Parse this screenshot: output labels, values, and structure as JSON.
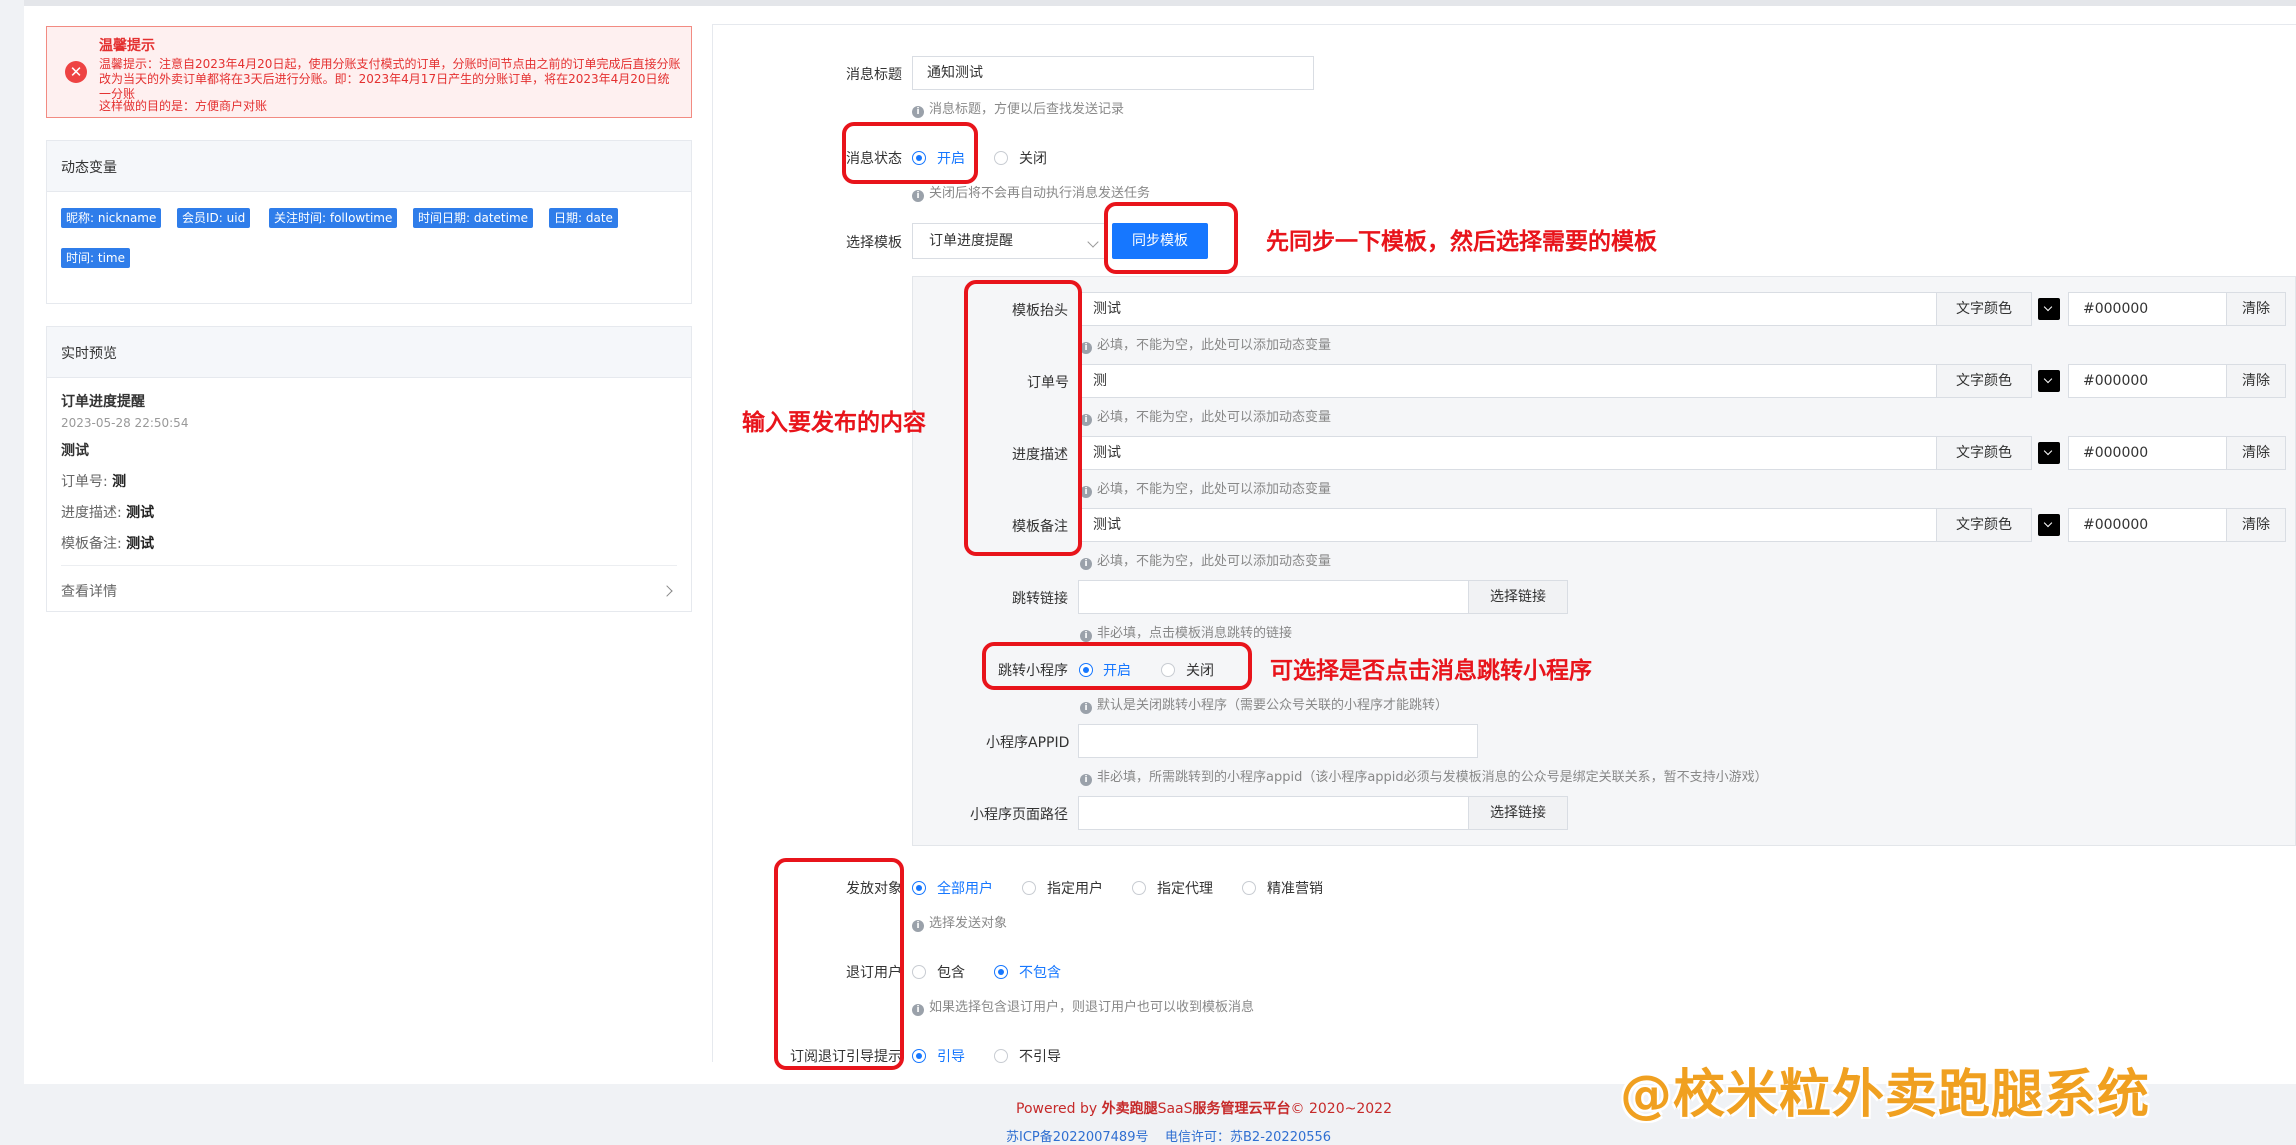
{
  "warning": {
    "title": "温馨提示",
    "text": "温馨提示：注意自2023年4月20日起，使用分账支付模式的订单，分账时间节点由之前的订单完成后直接分账改为当天的外卖订单都将在3天后进行分账。即：2023年4月17日产生的分账订单，将在2023年4月20日统一分账",
    "sub": "这样做的目的是：方便商户对账"
  },
  "variables": {
    "title": "动态变量",
    "tags": [
      "昵称: nickname",
      "会员ID: uid",
      "关注时间: followtime",
      "时间日期: datetime",
      "日期: date",
      "时间: time"
    ]
  },
  "preview": {
    "title": "实时预览",
    "name": "订单进度提醒",
    "time": "2023-05-28 22:50:54",
    "head": "测试",
    "rows": [
      {
        "label": "订单号:",
        "value": "测"
      },
      {
        "label": "进度描述:",
        "value": "测试"
      },
      {
        "label": "模板备注:",
        "value": "测试"
      }
    ],
    "details": "查看详情"
  },
  "form": {
    "msg_title_label": "消息标题",
    "msg_title_value": "通知测试",
    "msg_title_help": "消息标题，方便以后查找发送记录",
    "status_label": "消息状态",
    "status_on": "开启",
    "status_off": "关闭",
    "status_help": "关闭后将不会再自动执行消息发送任务",
    "template_label": "选择模板",
    "template_value": "订单进度提醒",
    "sync_button": "同步模板",
    "fields": [
      {
        "label": "模板抬头",
        "value": "测试"
      },
      {
        "label": "订单号",
        "value": "测"
      },
      {
        "label": "进度描述",
        "value": "测试"
      },
      {
        "label": "模板备注",
        "value": "测试"
      }
    ],
    "field_help": "必填，不能为空，此处可以添加动态变量",
    "color_label": "文字颜色",
    "color_value": "#000000",
    "clear_label": "清除",
    "link_label": "跳转链接",
    "choose_link": "选择链接",
    "link_help": "非必填，点击模板消息跳转的链接",
    "mini_label": "跳转小程序",
    "mini_on": "开启",
    "mini_off": "关闭",
    "mini_help": "默认是关闭跳转小程序（需要公众号关联的小程序才能跳转）",
    "appid_label": "小程序APPID",
    "appid_help": "非必填，所需跳转到的小程序appid（该小程序appid必须与发模板消息的公众号是绑定关联关系，暂不支持小游戏）",
    "path_label": "小程序页面路径",
    "target_label": "发放对象",
    "target_options": [
      "全部用户",
      "指定用户",
      "指定代理",
      "精准营销"
    ],
    "target_help": "选择发送对象",
    "unsub_label": "退订用户",
    "unsub_include": "包含",
    "unsub_exclude": "不包含",
    "unsub_help": "如果选择包含退订用户，则退订用户也可以收到模板消息",
    "guide_label": "订阅退订引导提示",
    "guide_on": "引导",
    "guide_off": "不引导"
  },
  "notes": {
    "sync": "先同步一下模板，然后选择需要的模板",
    "content": "输入要发布的内容",
    "mini": "可选择是否点击消息跳转小程序"
  },
  "footer": {
    "powered_prefix": "Powered by ",
    "platform": "外卖跑腿",
    "saas": "SaaS",
    "platform_suffix": "服务管理云平台",
    "copyright": "© 2020~2022",
    "icp": "苏ICP备2022007489号",
    "license": "电信许可：苏B2-20220556"
  },
  "watermark": "@校米粒外卖跑腿系统",
  "colors": {
    "primary": "#1677ff",
    "danger": "#e8141b",
    "watermark": "#f0a020"
  }
}
